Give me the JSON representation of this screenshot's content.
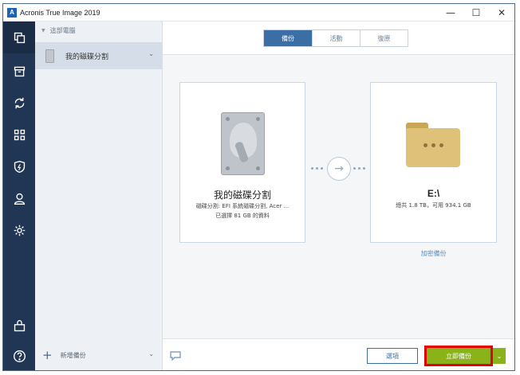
{
  "window": {
    "app_logo": "A",
    "title": "Acronis True Image 2019",
    "minimize": "—",
    "maximize": "☐",
    "close": "✕"
  },
  "nav": {
    "items": [
      {
        "icon": "copy-icon"
      },
      {
        "icon": "archive-icon"
      },
      {
        "icon": "sync-icon"
      },
      {
        "icon": "grid-icon"
      },
      {
        "icon": "shield-icon"
      },
      {
        "icon": "user-icon"
      },
      {
        "icon": "gear-icon"
      },
      {
        "icon": "store-icon"
      },
      {
        "icon": "help-icon"
      }
    ]
  },
  "sidebar": {
    "group_label": "這部電腦",
    "backup_item_label": "我的磁碟分割",
    "add_backup_label": "新增備份"
  },
  "tabs": [
    {
      "label": "備份",
      "active": true
    },
    {
      "label": "活動",
      "active": false
    },
    {
      "label": "復原",
      "active": false
    }
  ],
  "source": {
    "title": "我的磁碟分割",
    "subtitle": "磁碟分割: EFI 系統磁碟分割, Acer ...",
    "selected": "已選擇 81 GB 的資料"
  },
  "destination": {
    "title": "E:\\",
    "subtitle": "總共 1.8 TB，可用 934.1 GB"
  },
  "encrypt_link": "加密備份",
  "footer": {
    "options_label": "選項",
    "backup_now_label": "立即備份"
  },
  "colors": {
    "nav_bg": "#213654",
    "accent": "#3a6ea5",
    "primary_button": "#8ab31a",
    "highlight": "#e00000"
  }
}
